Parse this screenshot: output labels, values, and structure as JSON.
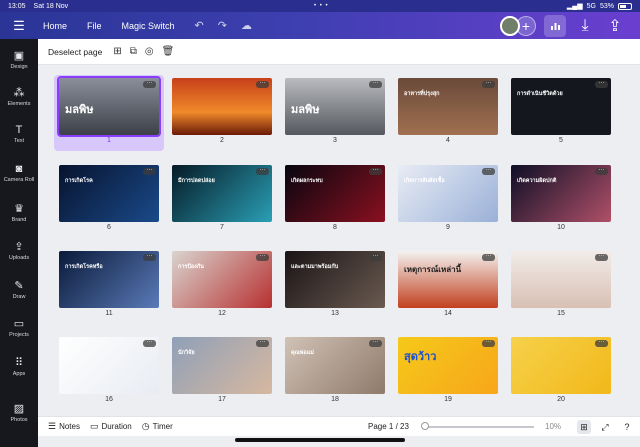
{
  "status": {
    "time": "13:05",
    "date": "Sat 18 Nov",
    "center_dots": "• • •",
    "signal": "5G",
    "battery": "53%",
    "battery_level": 0.53
  },
  "topbar": {
    "menu_icon": "hamburger-icon",
    "home": "Home",
    "file": "File",
    "magic_switch": "Magic Switch",
    "plus": "+"
  },
  "toolbar": {
    "deselect": "Deselect page"
  },
  "sidebar": [
    {
      "label": "Design",
      "icon": "design-icon",
      "glyph": "▣"
    },
    {
      "label": "Elements",
      "icon": "elements-icon",
      "glyph": "⁂"
    },
    {
      "label": "Text",
      "icon": "text-icon",
      "glyph": "T"
    },
    {
      "label": "Camera Roll",
      "icon": "camera-icon",
      "glyph": "◙"
    },
    {
      "label": "Brand",
      "icon": "brand-icon",
      "glyph": "♛"
    },
    {
      "label": "Uploads",
      "icon": "upload-icon",
      "glyph": "⇪"
    },
    {
      "label": "Draw",
      "icon": "draw-icon",
      "glyph": "✎"
    },
    {
      "label": "Projects",
      "icon": "folder-icon",
      "glyph": "▭"
    },
    {
      "label": "Apps",
      "icon": "apps-icon",
      "glyph": "⠿"
    },
    {
      "label": "Photos",
      "icon": "photos-icon",
      "glyph": "▨"
    }
  ],
  "pages": [
    {
      "n": "1",
      "title": "มลพิษ",
      "bg": "linear-gradient(180deg,#8a8f9a,#3d4048)"
    },
    {
      "n": "2",
      "title": "",
      "bg": "linear-gradient(180deg,#c8401a,#f08a2a 60%,#6a1a08)"
    },
    {
      "n": "3",
      "title": "มลพิษ",
      "bg": "linear-gradient(180deg,#b9bbbf,#55585e)"
    },
    {
      "n": "4",
      "title": "อาหารที่ปรุงสุก",
      "bg": "linear-gradient(180deg,#6a4a3a,#a07050)"
    },
    {
      "n": "5",
      "title": "การดำเนินชีวิตด้วย",
      "bg": "#15171f"
    },
    {
      "n": "6",
      "title": "การเกิดโรค",
      "bg": "linear-gradient(135deg,#07132e,#1a4a8a)"
    },
    {
      "n": "7",
      "title": "มีการปลดปล่อย",
      "bg": "linear-gradient(135deg,#061a26,#2a9fb5)"
    },
    {
      "n": "8",
      "title": "เกิดผลกระทบ",
      "bg": "linear-gradient(135deg,#07060f,#8a1020)"
    },
    {
      "n": "9",
      "title": "เกิดการสัมผัสเชื้อ",
      "bg": "linear-gradient(135deg,#e8ecf4,#9ab0d8)"
    },
    {
      "n": "10",
      "title": "เกิดความผิดปกติ",
      "bg": "linear-gradient(135deg,#0d0f26,#b05068)"
    },
    {
      "n": "11",
      "title": "การเกิดโรคหรือ",
      "bg": "linear-gradient(135deg,#0a1a3a,#5a7ab8)"
    },
    {
      "n": "12",
      "title": "การป้องกัน",
      "bg": "linear-gradient(135deg,#d9d4cf,#b73030)"
    },
    {
      "n": "13",
      "title": "และตามมาพร้อมกับ",
      "bg": "linear-gradient(135deg,#1a1416,#6a5a50)"
    },
    {
      "n": "14",
      "title": "เหตุการณ์เหล่านี้",
      "bg": "linear-gradient(180deg,#f4f2f0,#c24020)"
    },
    {
      "n": "15",
      "title": "",
      "bg": "linear-gradient(180deg,#f2ece8,#d8c0b4)"
    },
    {
      "n": "16",
      "title": "",
      "bg": "linear-gradient(135deg,#ffffff,#e8ecf2)"
    },
    {
      "n": "17",
      "title": "นักวิจัย",
      "bg": "linear-gradient(135deg,#8fa0b8,#d7b8a0)"
    },
    {
      "n": "18",
      "title": "คุณพ่อแม่",
      "bg": "linear-gradient(135deg,#d0c2b6,#8f7a6a)"
    },
    {
      "n": "19",
      "title": "สุดว้าว",
      "bg": "linear-gradient(135deg,#f5c91a,#f8a61a)"
    },
    {
      "n": "20",
      "title": "",
      "bg": "linear-gradient(135deg,#f6d14a,#f2b81a)"
    }
  ],
  "bottombar": {
    "notes": "Notes",
    "duration": "Duration",
    "timer": "Timer",
    "page_indicator": "Page 1 / 23",
    "zoom": "10%",
    "zoom_level": 0.1
  }
}
